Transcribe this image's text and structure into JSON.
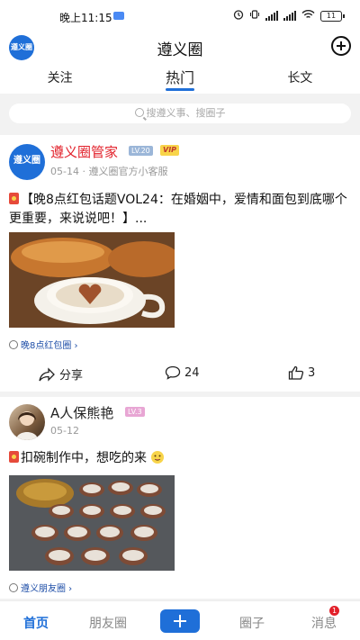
{
  "status_bar": {
    "time": "晚上11:15",
    "battery": "11"
  },
  "header": {
    "title": "遵义圈",
    "logo_text": "遵义圈"
  },
  "tabs": [
    {
      "label": "关注",
      "active": false
    },
    {
      "label": "热门",
      "active": true
    },
    {
      "label": "长文",
      "active": false
    }
  ],
  "search": {
    "placeholder": "搜遵义事、搜圈子"
  },
  "posts": [
    {
      "author": "遵义圈管家",
      "avatar_text": "遵义圈",
      "level": "LV.20",
      "vip": "VIP",
      "date": "05-14",
      "subtitle": "遵义圈官方小客服",
      "text": "【晚8点红包话题VOL24：在婚姻中，爱情和面包到底哪个更重要，来说说吧！】...",
      "circle": "晚8点红包圈",
      "share_label": "分享",
      "comments": "24",
      "likes": "3"
    },
    {
      "author": "A人保熊艳",
      "level": "LV.3",
      "date": "05-12",
      "text": "扣碗制作中，想吃的来",
      "circle": "遵义朋友圈"
    }
  ],
  "bottom_nav": {
    "home": "首页",
    "friends": "朋友圈",
    "circles": "圈子",
    "messages": "消息",
    "messages_badge": "1"
  },
  "colors": {
    "accent": "#1f6fd8",
    "name_red": "#e2202a",
    "vip": "#f8d44a"
  }
}
